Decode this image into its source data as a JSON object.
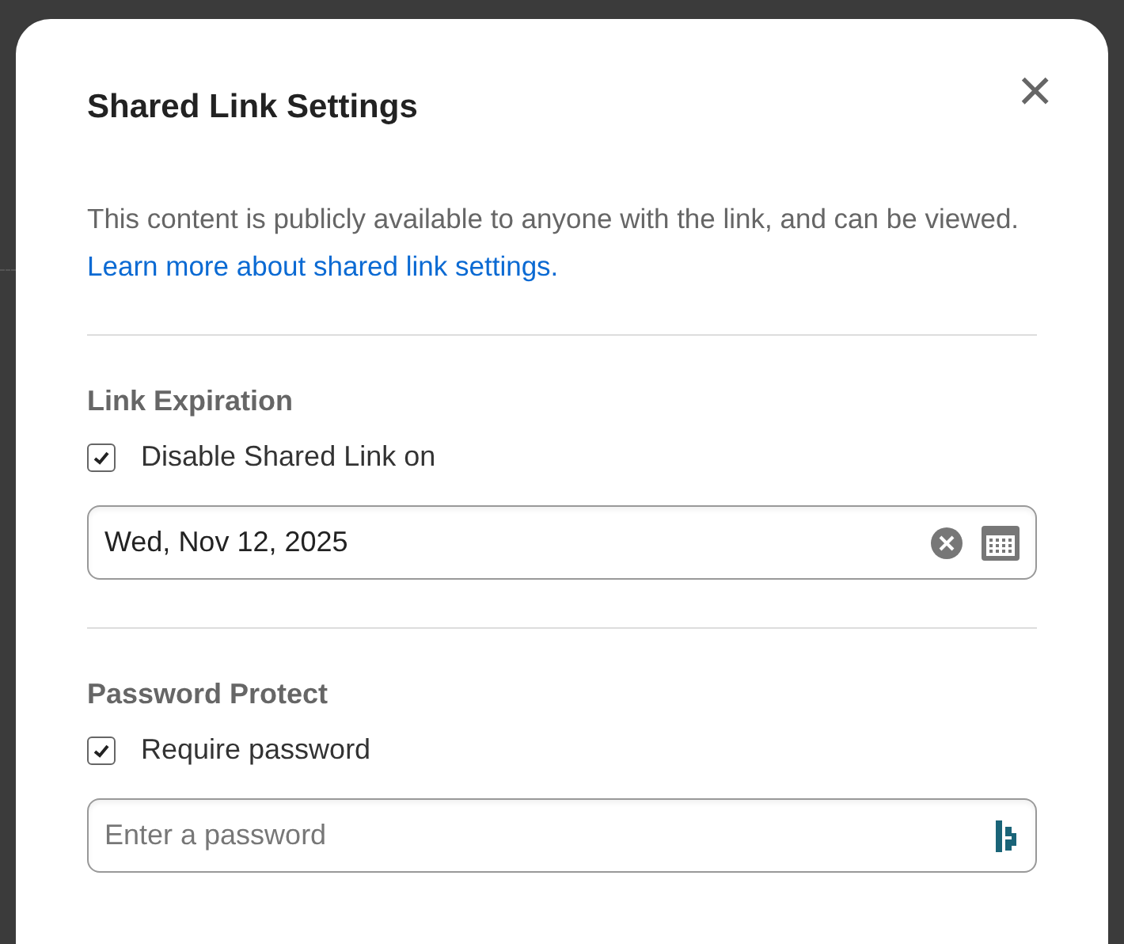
{
  "dialog": {
    "title": "Shared Link Settings",
    "close": "×",
    "description": "This content is publicly available to anyone with the link, and can be viewed.",
    "link": "Learn more about shared link settings.",
    "sections": [
      {
        "heading": "Link Expiration",
        "checkbox": {
          "label": "Disable Shared Link on",
          "checked": true
        },
        "field": {
          "kind": "date",
          "value": "Wed, Nov 12, 2025"
        }
      },
      {
        "heading": "Password Protect",
        "checkbox": {
          "label": "Require password",
          "checked": true
        },
        "field": {
          "kind": "password",
          "placeholder": "Enter a password"
        }
      }
    ]
  }
}
